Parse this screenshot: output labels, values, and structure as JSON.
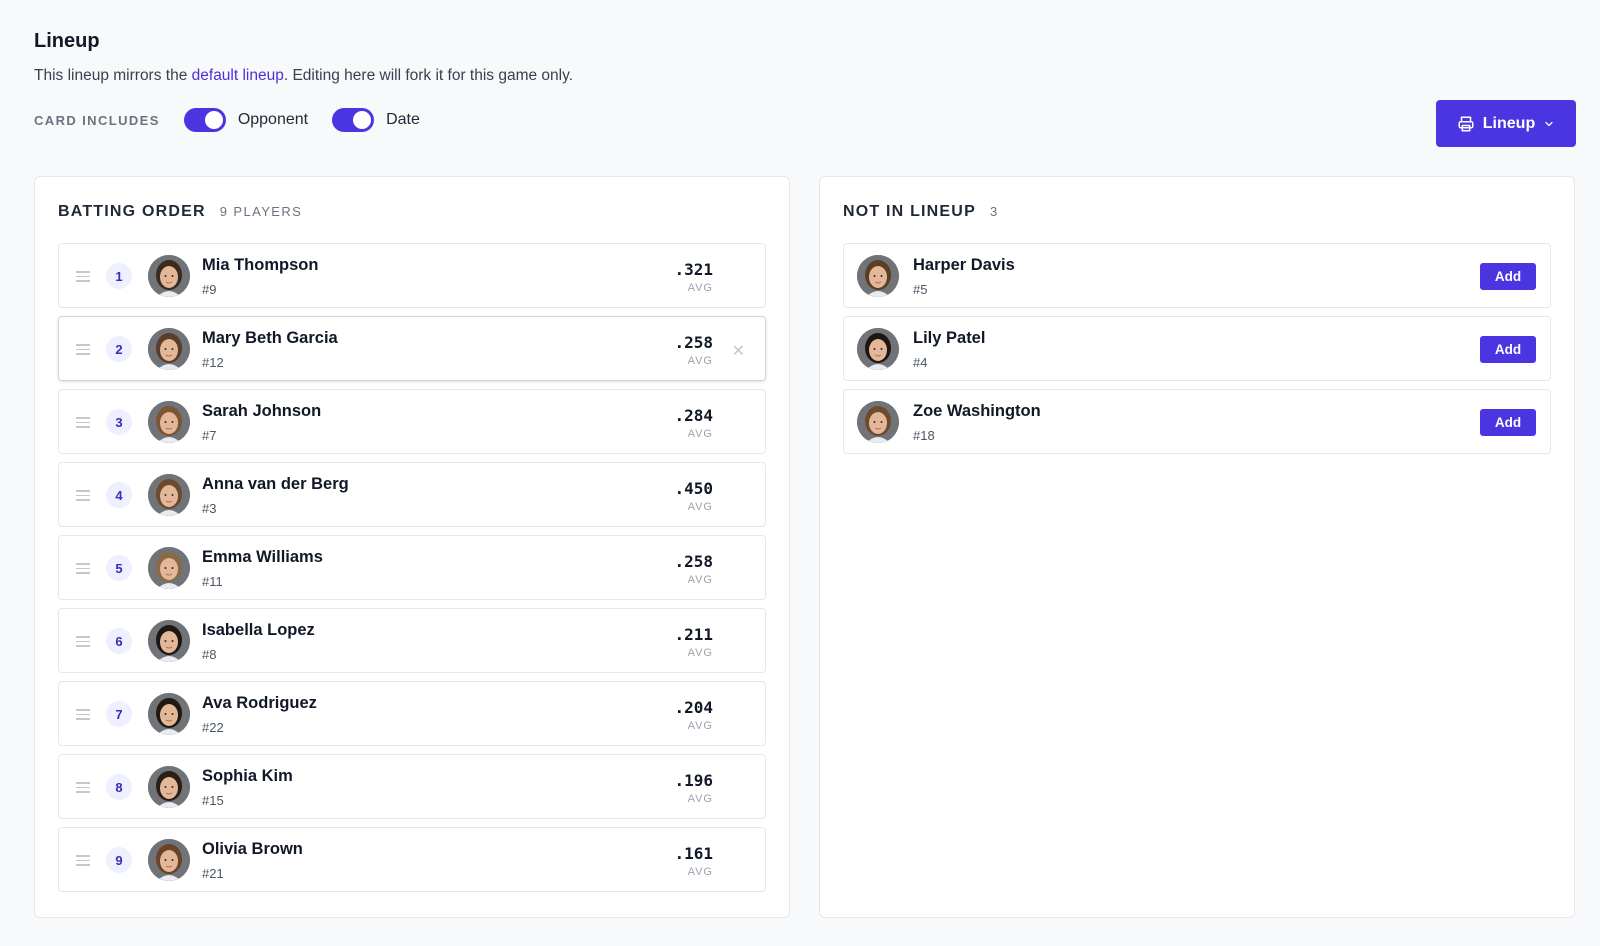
{
  "header": {
    "title": "Lineup",
    "subtitle_prefix": "This lineup mirrors the ",
    "subtitle_link": "default lineup",
    "subtitle_suffix": ". Editing here will fork it for this game only."
  },
  "controls": {
    "card_includes_label": "CARD INCLUDES",
    "toggles": [
      {
        "label": "Opponent",
        "on": true
      },
      {
        "label": "Date",
        "on": true
      }
    ],
    "print_button_label": "Lineup"
  },
  "batting_order": {
    "title": "BATTING ORDER",
    "count_label": "9 PLAYERS",
    "players": [
      {
        "order": "1",
        "name": "Mia Thompson",
        "number": "#9",
        "avg": ".321",
        "avg_label": "AVG",
        "hair": "#3b2a20"
      },
      {
        "order": "2",
        "name": "Mary Beth Garcia",
        "number": "#12",
        "avg": ".258",
        "avg_label": "AVG",
        "hair": "#5a3d2b"
      },
      {
        "order": "3",
        "name": "Sarah Johnson",
        "number": "#7",
        "avg": ".284",
        "avg_label": "AVG",
        "hair": "#7a5634"
      },
      {
        "order": "4",
        "name": "Anna van der Berg",
        "number": "#3",
        "avg": ".450",
        "avg_label": "AVG",
        "hair": "#6b4a2e"
      },
      {
        "order": "5",
        "name": "Emma Williams",
        "number": "#11",
        "avg": ".258",
        "avg_label": "AVG",
        "hair": "#8a6a45"
      },
      {
        "order": "6",
        "name": "Isabella Lopez",
        "number": "#8",
        "avg": ".211",
        "avg_label": "AVG",
        "hair": "#1f1712"
      },
      {
        "order": "7",
        "name": "Ava Rodriguez",
        "number": "#22",
        "avg": ".204",
        "avg_label": "AVG",
        "hair": "#221812"
      },
      {
        "order": "8",
        "name": "Sophia Kim",
        "number": "#15",
        "avg": ".196",
        "avg_label": "AVG",
        "hair": "#2a1e16"
      },
      {
        "order": "9",
        "name": "Olivia Brown",
        "number": "#21",
        "avg": ".161",
        "avg_label": "AVG",
        "hair": "#6a4428"
      }
    ]
  },
  "not_in_lineup": {
    "title": "NOT IN LINEUP",
    "count_label": "3",
    "add_label": "Add",
    "players": [
      {
        "name": "Harper Davis",
        "number": "#5",
        "hair": "#5c3e27"
      },
      {
        "name": "Lily Patel",
        "number": "#4",
        "hair": "#1e1611"
      },
      {
        "name": "Zoe Washington",
        "number": "#18",
        "hair": "#6e4b2d"
      }
    ]
  },
  "colors": {
    "accent": "#4a35e0",
    "link": "#4f2fd8",
    "badge_bg": "#eef0ff",
    "badge_text": "#3b2bb8"
  },
  "icons": {
    "print": "printer-icon",
    "dropdown": "chevron-down-icon",
    "drag": "drag-handle-icon",
    "remove": "close-icon"
  }
}
